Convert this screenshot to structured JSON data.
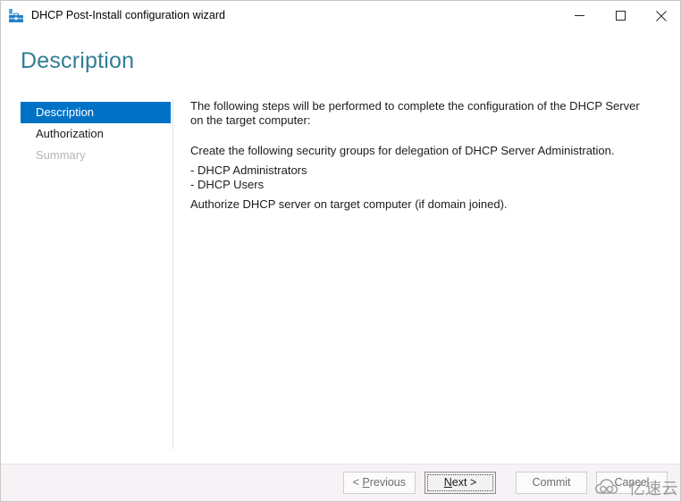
{
  "window": {
    "title": "DHCP Post-Install configuration wizard",
    "icon": "dhcp-server-icon",
    "controls": {
      "minimize": "minimize-icon",
      "maximize": "maximize-icon",
      "close": "close-icon"
    }
  },
  "page": {
    "heading": "Description",
    "heading_color": "#2f7f94"
  },
  "nav": {
    "accent_color": "#0072c6",
    "items": [
      {
        "label": "Description",
        "state": "selected"
      },
      {
        "label": "Authorization",
        "state": "normal"
      },
      {
        "label": "Summary",
        "state": "disabled"
      }
    ]
  },
  "content": {
    "intro": "The following steps will be performed to complete the configuration of the DHCP Server on the target computer:",
    "groups_heading": "Create the following security groups for delegation of DHCP Server Administration.",
    "bullets": [
      "- DHCP Administrators",
      "- DHCP Users"
    ],
    "authorize": "Authorize DHCP server on target computer (if domain joined)."
  },
  "footer": {
    "buttons": [
      {
        "name": "previous",
        "prefix": "< ",
        "accel": "P",
        "rest": "revious",
        "suffix": "",
        "state": "disabled",
        "focused": false
      },
      {
        "name": "next",
        "prefix": "",
        "accel": "N",
        "rest": "ext",
        "suffix": " >",
        "state": "enabled",
        "focused": true
      },
      {
        "name": "commit",
        "prefix": "",
        "accel": "",
        "rest": "Commit",
        "suffix": "",
        "state": "disabled",
        "focused": false
      },
      {
        "name": "cancel",
        "prefix": "",
        "accel": "",
        "rest": "Cancel",
        "suffix": "",
        "state": "disabled",
        "focused": false
      }
    ]
  },
  "watermark": {
    "text": "亿速云",
    "logo": "cloud-logo"
  }
}
